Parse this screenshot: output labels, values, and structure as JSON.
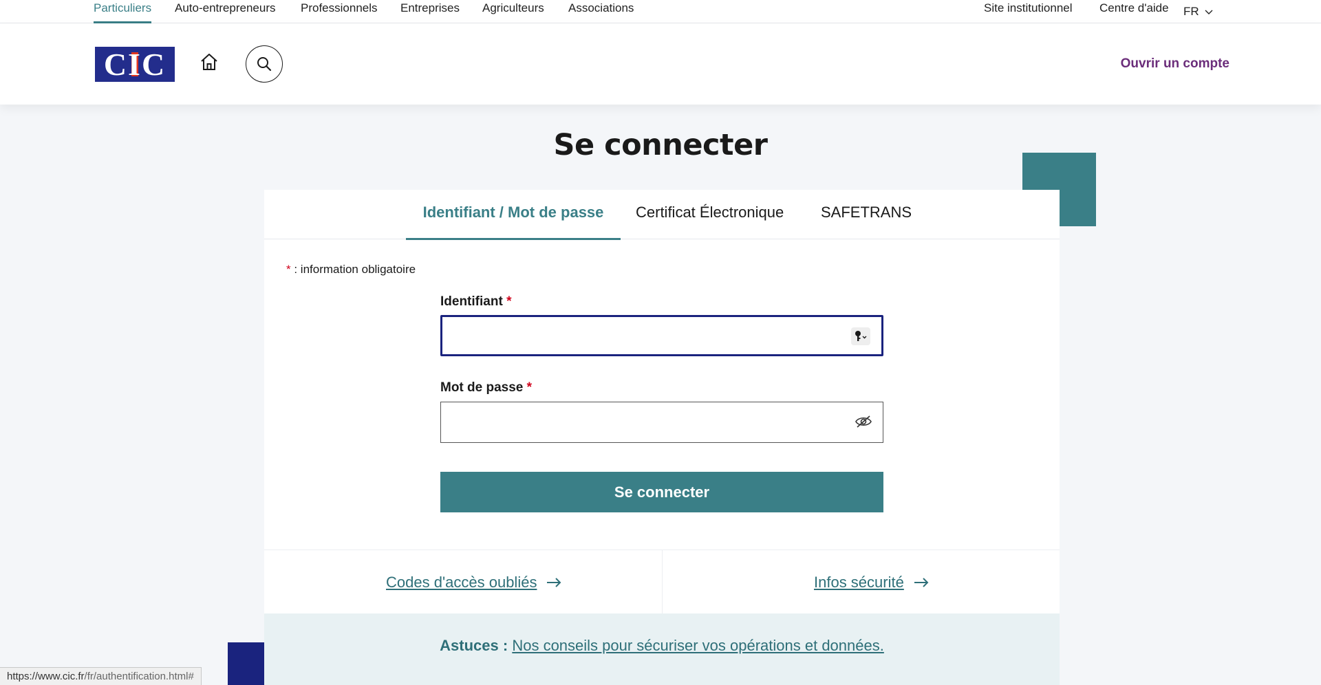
{
  "topnav": {
    "left": [
      "Particuliers",
      "Auto-entrepreneurs",
      "Professionnels",
      "Entreprises",
      "Agriculteurs",
      "Associations"
    ],
    "right": [
      "Site institutionnel",
      "Centre d'aide"
    ],
    "lang": "FR"
  },
  "header": {
    "logo_text": "CIC",
    "open_account": "Ouvrir un compte"
  },
  "page": {
    "title": "Se connecter"
  },
  "tabs": [
    {
      "label": "Identifiant / Mot de passe",
      "active": true
    },
    {
      "label": "Certificat Électronique",
      "active": false
    },
    {
      "label": "SAFETRANS",
      "active": false
    }
  ],
  "form": {
    "required_star": "*",
    "required_note": " : information obligatoire",
    "id_label": "Identifiant",
    "id_value": "",
    "password_label": "Mot de passe",
    "password_value": "",
    "submit_label": "Se connecter"
  },
  "links": {
    "forgot": "Codes d'accès oubliés",
    "security": "Infos sécurité"
  },
  "tips": {
    "prefix": "Astuces :",
    "link": "Nos conseils pour sécuriser vos opérations et données."
  },
  "status_bar": {
    "host": "https://www.cic.fr",
    "path": "/fr/authentification.html#"
  },
  "colors": {
    "accent": "#3a7f87",
    "brand_blue": "#232d8c",
    "brand_red": "#e2361f",
    "account_link": "#6b2d7a"
  }
}
